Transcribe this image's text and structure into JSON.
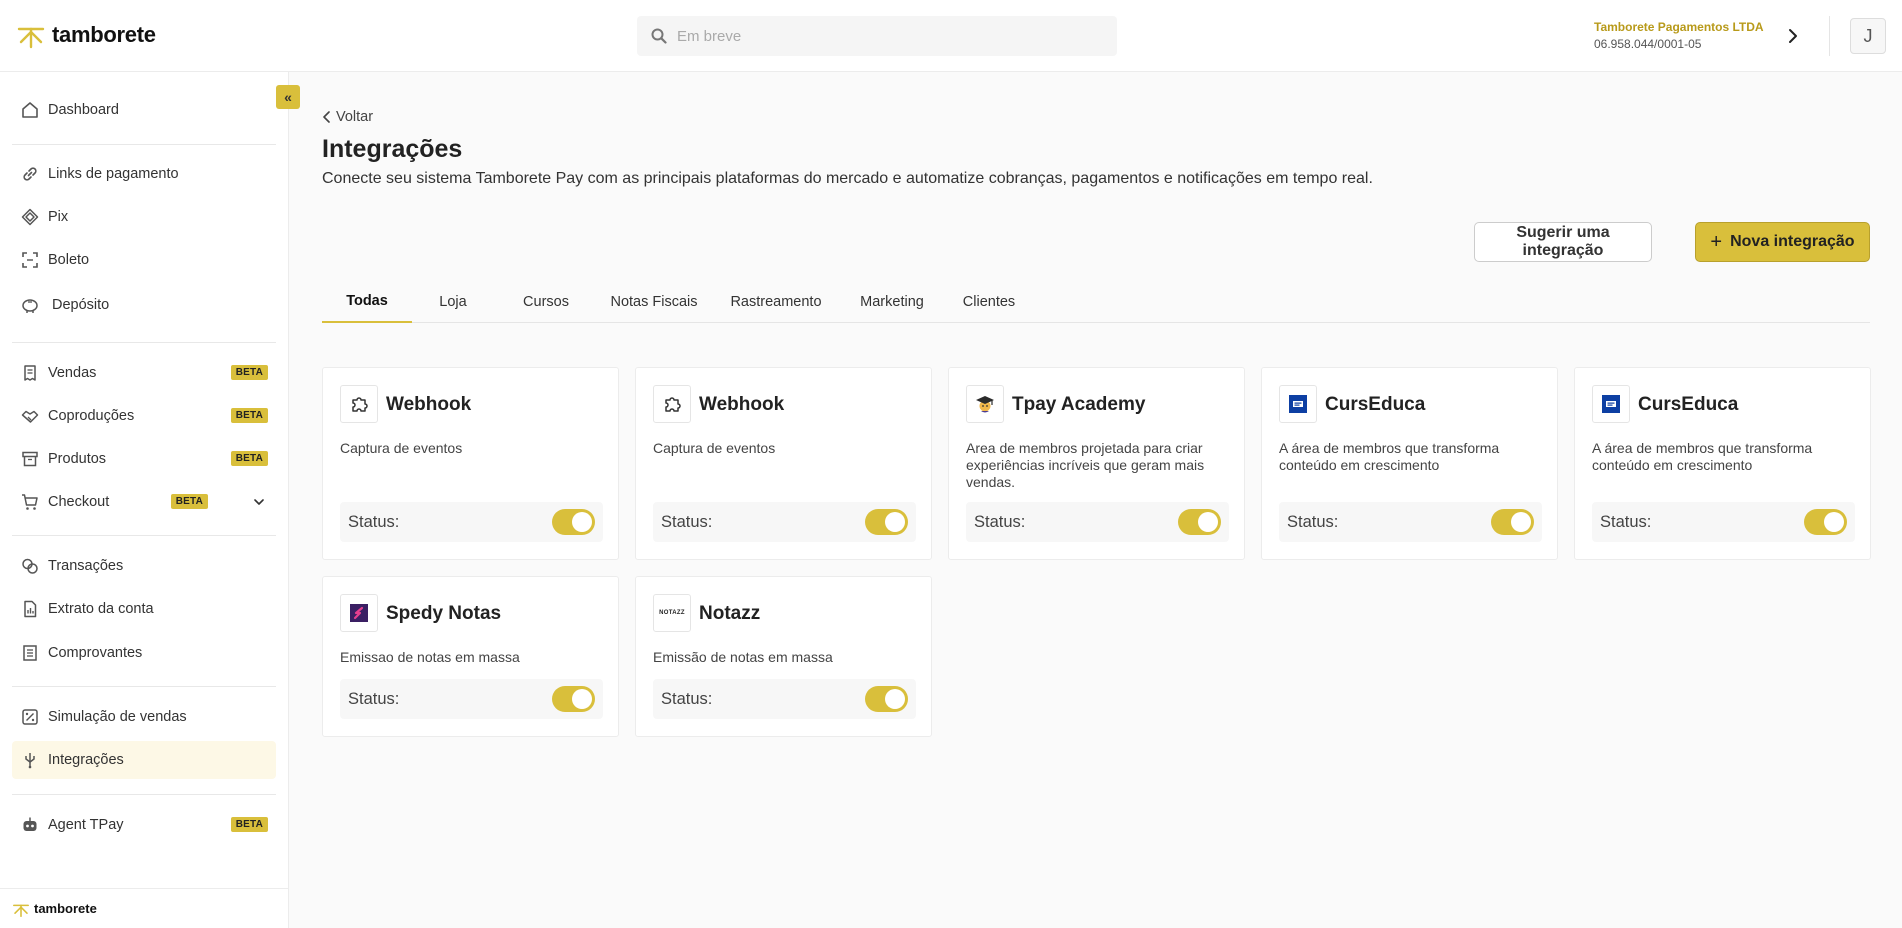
{
  "header": {
    "brand": "tamborete",
    "search_placeholder": "Em breve",
    "company_name": "Tamborete Pagamentos LTDA",
    "company_doc": "06.958.044/0001-05",
    "avatar_initial": "J"
  },
  "sidebar": {
    "collapse_label": "«",
    "items": [
      {
        "label": "Dashboard"
      },
      {
        "label": "Links de pagamento"
      },
      {
        "label": "Pix"
      },
      {
        "label": "Boleto"
      },
      {
        "label": "Depósito"
      },
      {
        "label": "Vendas",
        "badge": "BETA"
      },
      {
        "label": "Coproduções",
        "badge": "BETA"
      },
      {
        "label": "Produtos",
        "badge": "BETA"
      },
      {
        "label": "Checkout",
        "badge": "BETA"
      },
      {
        "label": "Transações"
      },
      {
        "label": "Extrato da conta"
      },
      {
        "label": "Comprovantes"
      },
      {
        "label": "Simulação de vendas"
      },
      {
        "label": "Integrações"
      },
      {
        "label": "Agent TPay",
        "badge": "BETA"
      }
    ],
    "footer_brand": "tamborete"
  },
  "main": {
    "back_label": "Voltar",
    "title": "Integrações",
    "description": "Conecte seu sistema Tamborete Pay com as principais plataformas do mercado e automatize cobranças, pagamentos e notificações em tempo real.",
    "suggest_button": "Sugerir uma integração",
    "new_button": "Nova integração",
    "tabs": [
      {
        "label": "Todas"
      },
      {
        "label": "Loja"
      },
      {
        "label": "Cursos"
      },
      {
        "label": "Notas Fiscais"
      },
      {
        "label": "Rastreamento"
      },
      {
        "label": "Marketing"
      },
      {
        "label": "Clientes"
      }
    ],
    "status_label": "Status:",
    "cards": [
      {
        "title": "Webhook",
        "description": "Captura de eventos",
        "icon": "puzzle-icon",
        "enabled": true
      },
      {
        "title": "Webhook",
        "description": "Captura de eventos",
        "icon": "puzzle-icon",
        "enabled": true
      },
      {
        "title": "Tpay Academy",
        "description": "Area de membros projetada para criar experiências incríveis que geram mais vendas.",
        "icon": "graduation-cap-icon",
        "enabled": true
      },
      {
        "title": "CursEduca",
        "description": "A área de membros que transforma conteúdo em crescimento",
        "icon": "curseduca-logo-icon",
        "enabled": true
      },
      {
        "title": "CursEduca",
        "description": "A área de membros que transforma conteúdo em crescimento",
        "icon": "curseduca-logo-icon",
        "enabled": true
      },
      {
        "title": "Spedy Notas",
        "description": "Emissao de notas em massa",
        "icon": "spedy-logo-icon",
        "enabled": true
      },
      {
        "title": "Notazz",
        "description": "Emissão de notas em massa",
        "icon": "notazz-logo-icon",
        "logo_text": "NOTAZZ",
        "enabled": true
      }
    ]
  },
  "colors": {
    "accent": "#d9bf3b",
    "accent_text": "#b89a1a",
    "active_bg": "#fdf8e6"
  }
}
